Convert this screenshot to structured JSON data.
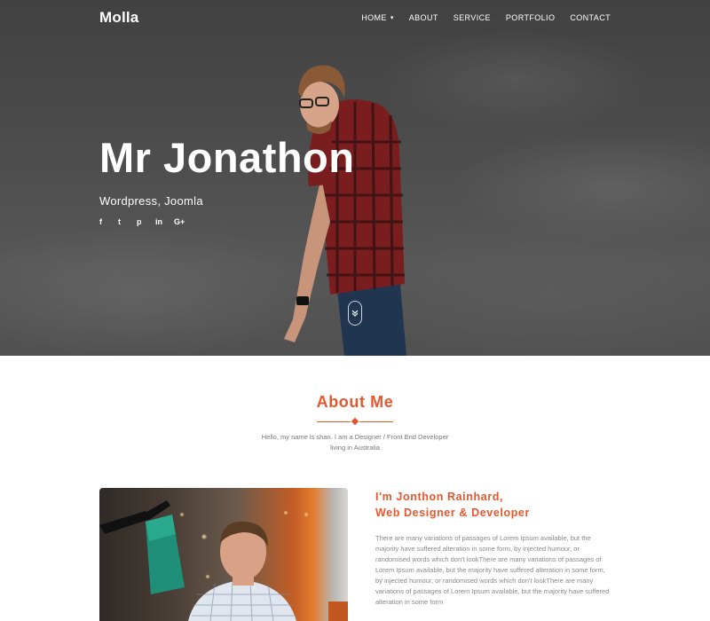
{
  "brand": {
    "logo": "Molla"
  },
  "nav": {
    "items": [
      {
        "label": "HOME",
        "has_dropdown": true
      },
      {
        "label": "ABOUT"
      },
      {
        "label": "SERVICE"
      },
      {
        "label": "PORTFOLIO"
      },
      {
        "label": "CONTACT"
      }
    ]
  },
  "hero": {
    "title": "Mr Jonathon",
    "subtitle": "Wordpress, Joomla",
    "socials": [
      {
        "icon": "facebook-icon",
        "glyph": "f"
      },
      {
        "icon": "twitter-icon",
        "glyph": "t"
      },
      {
        "icon": "pinterest-icon",
        "glyph": "p"
      },
      {
        "icon": "linkedin-icon",
        "glyph": "in"
      },
      {
        "icon": "google-plus-icon",
        "glyph": "G+"
      }
    ],
    "scroll_icon": "chevron-double-down-icon"
  },
  "about": {
    "title": "About Me",
    "intro_line1": "Hello, my name is shan. I am a Designer / Front End Developer",
    "intro_line2": "living in Australia"
  },
  "bio": {
    "heading_line1": "I'm Jonthon Rainhard,",
    "heading_line2": "Web Designer & Developer",
    "lines": [
      "There are many variations of passages of Lorem Ipsum available, but the",
      "majority have suffered alteration in some form, by injected humour, or",
      "randomised words which don't lookThere are many variations of passages of",
      "Lorem Ipsum available, but the majority have suffered alteration in some form,",
      "by injected humour, or randomised words which don't lookThere are many",
      "variations of passages of Lorem Ipsum available, but the majority have suffered",
      "alteration in some form"
    ]
  },
  "colors": {
    "accent": "#e4572e",
    "hero_overlay": "#4f4f4f",
    "text_muted": "#888888"
  }
}
